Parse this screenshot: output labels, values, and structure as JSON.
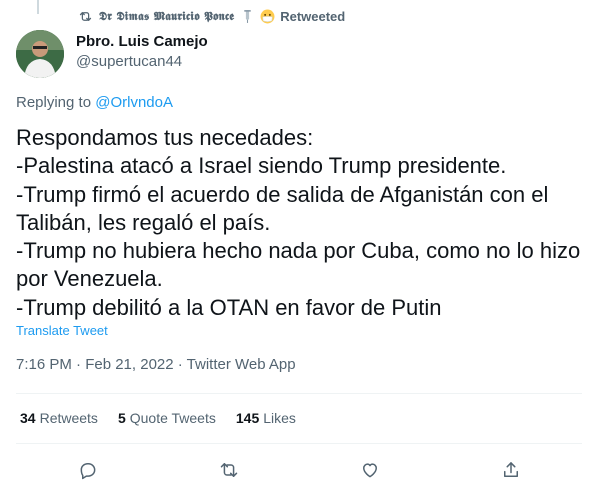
{
  "retweet_banner": {
    "name": "𝕯𝖗 𝕯𝖎𝖒𝖆𝖘 𝕸𝖆𝖚𝖗𝖎𝖈𝖎𝖔 𝕻𝖔𝖓𝖈𝖊",
    "label": "Retweeted"
  },
  "author": {
    "name": "Pbro. Luis Camejo",
    "handle": "@supertucan44"
  },
  "replying": {
    "prefix": "Replying to ",
    "handle": "@OrlvndoA"
  },
  "tweet": {
    "text": "Respondamos tus necedades:\n-Palestina atacó a Israel siendo Trump presidente.\n-Trump firmó el acuerdo de salida de Afganistán con el Talibán, les regaló el país.\n-Trump no hubiera hecho nada por Cuba, como no lo hizo por Venezuela.\n-Trump debilitó a la OTAN en favor de Putin",
    "translate_label": "Translate Tweet",
    "meta": "7:16 PM · Feb 21, 2022 · Twitter Web App"
  },
  "stats": {
    "retweets_count": "34",
    "retweets_label": "Retweets",
    "quotes_count": "5",
    "quotes_label": "Quote Tweets",
    "likes_count": "145",
    "likes_label": "Likes"
  },
  "icons": {
    "retweet_banner": "retweet-icon",
    "reply": "reply-icon",
    "retweet": "retweet-icon",
    "like": "heart-icon",
    "share": "share-icon"
  },
  "colors": {
    "text": "#0f1419",
    "secondary": "#536471",
    "link": "#1d9bf0",
    "divider": "#eff3f4"
  }
}
